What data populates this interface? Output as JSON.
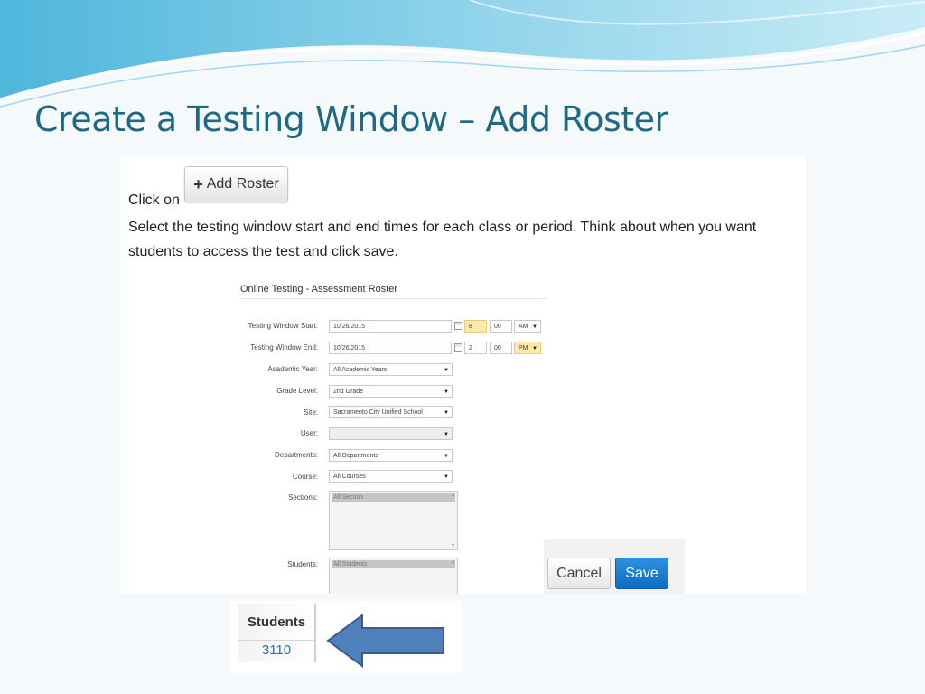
{
  "slide": {
    "title": "Create a Testing Window – Add Roster"
  },
  "instructions": {
    "click_on": "Click on",
    "line1": "Select the testing window start and end times for each class or period.  Think about when you want",
    "line2": "students to access the test and click save."
  },
  "add_roster_button": {
    "icon": "plus-icon",
    "label": "Add Roster"
  },
  "form": {
    "title": "Online Testing - Assessment Roster",
    "window_start": {
      "label": "Testing Window Start:",
      "date": "10/26/2015",
      "hour": "8",
      "minute": "00",
      "ampm": "AM"
    },
    "window_end": {
      "label": "Testing Window End:",
      "date": "10/26/2015",
      "hour": "2",
      "minute": "00",
      "ampm": "PM"
    },
    "academic_year": {
      "label": "Academic Year:",
      "value": "All Academic Years"
    },
    "grade_level": {
      "label": "Grade Level:",
      "value": "2nd Grade"
    },
    "site": {
      "label": "Site:",
      "value": "Sacramento City Unified School"
    },
    "user": {
      "label": "User:",
      "value": ""
    },
    "departments": {
      "label": "Departments:",
      "value": "All Departments"
    },
    "course": {
      "label": "Course:",
      "value": "All Courses"
    },
    "sections": {
      "label": "Sections:",
      "selected": "All Section"
    },
    "students": {
      "label": "Students:",
      "selected": "All Students"
    }
  },
  "buttons": {
    "cancel": "Cancel",
    "save": "Save"
  },
  "students_summary": {
    "header": "Students",
    "count": "3110"
  },
  "colors": {
    "title": "#1d6a85",
    "save_button": "#1a7ad6",
    "highlight_field": "#fce8a8",
    "arrow_fill": "#4f81bd"
  }
}
